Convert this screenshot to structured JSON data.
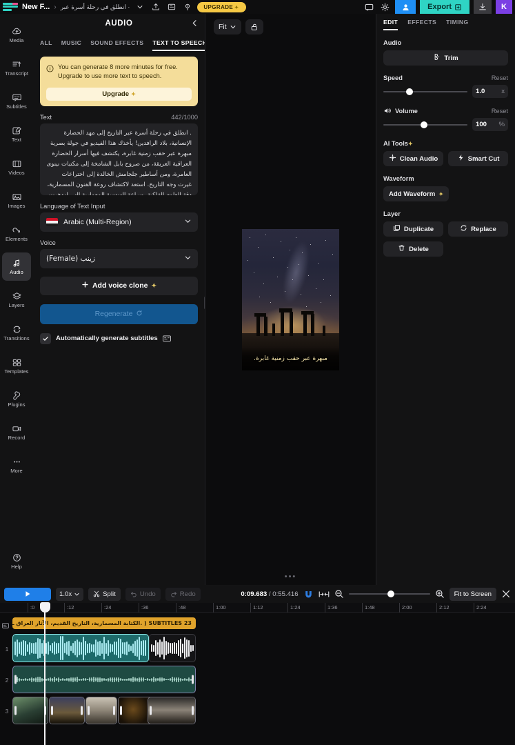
{
  "topbar": {
    "project_name": "New F...",
    "breadcrumb_separator": "›",
    "breadcrumb_arabic": "· انطلق في رحلة أسرة عبر",
    "upgrade_label": "UPGRADE",
    "sparkle": "✦",
    "export_label": "Export",
    "avatar_initial": "K",
    "icons": [
      "logo-icon",
      "chevron-down-icon",
      "upload-icon",
      "present-icon",
      "pin-icon",
      "comment-icon",
      "gear-icon",
      "invite-user-icon",
      "export-icon",
      "download-icon"
    ]
  },
  "rail": {
    "items": [
      {
        "label": "Media",
        "icon": "media-cloud-icon",
        "active": false
      },
      {
        "label": "Transcript",
        "icon": "transcript-icon",
        "active": false
      },
      {
        "label": "Subtitles",
        "icon": "subtitles-icon",
        "active": false
      },
      {
        "label": "Text",
        "icon": "text-edit-icon",
        "active": false
      },
      {
        "label": "Videos",
        "icon": "video-icon",
        "active": false
      },
      {
        "label": "Images",
        "icon": "image-icon",
        "active": false
      },
      {
        "label": "Elements",
        "icon": "elements-icon",
        "active": false
      },
      {
        "label": "Audio",
        "icon": "audio-note-icon",
        "active": true
      },
      {
        "label": "Layers",
        "icon": "layers-icon",
        "active": false
      },
      {
        "label": "Transitions",
        "icon": "transitions-icon",
        "active": false
      },
      {
        "label": "Templates",
        "icon": "templates-grid-icon",
        "active": false
      },
      {
        "label": "Plugins",
        "icon": "plugins-icon",
        "active": false
      },
      {
        "label": "Record",
        "icon": "record-camera-icon",
        "active": false
      },
      {
        "label": "More",
        "icon": "more-dots-icon",
        "active": false
      }
    ],
    "help_label": "Help"
  },
  "panel": {
    "title": "AUDIO",
    "tabs": [
      {
        "label": "ALL",
        "active": false
      },
      {
        "label": "MUSIC",
        "active": false
      },
      {
        "label": "SOUND EFFECTS",
        "active": false
      },
      {
        "label": "TEXT TO SPEECH",
        "active": true
      }
    ],
    "notice": {
      "line1": "You can generate 8 more minutes for free.",
      "line2": "Upgrade to use more text to speech.",
      "button_label": "Upgrade",
      "sparkle": "✦"
    },
    "text_field": {
      "label": "Text",
      "counter": "442/1000",
      "value": ". انطلق في رحلة أسرة عبر التاريخ إلى مهد الحضارة الإنسانية، بلاد الرافدين! يأخذك هذا الفيديو في جولة بصرية مبهرة عبر حقب زمنية غابرة، يكتشف فيها أسرار الحضارة العراقية العريقة، من صروح بابل الشامخة إلى مكتبات نينوى العامرة، ومن أساطير جلجامش الخالدة إلى اختراعات غيرت وجه التاريخ. استعد لاكتشاف روعة الفنون المسمارية، دقة العلوم الفلكية، وبراعة الهندسة المعمارية التي ازدهرت في بلاد ما بين النهرين. لتشكل"
    },
    "language_field": {
      "label": "Language of Text Input",
      "value": "Arabic (Multi-Region)",
      "flag": "iraq-flag-icon"
    },
    "voice_field": {
      "label": "Voice",
      "value": "زينب (Female)"
    },
    "add_voice_clone_label": "Add voice clone",
    "regenerate_label": "Regenerate",
    "auto_subtitles_label": "Automatically generate subtitles",
    "auto_subtitles_checked": true
  },
  "stage": {
    "fit_label": "Fit",
    "lock_icon": "unlock-icon",
    "subtitle_text": "مبهرة عبر حقب زمنية غابرة.",
    "handle_dots": "•••"
  },
  "inspector": {
    "tabs": [
      {
        "label": "EDIT",
        "active": true
      },
      {
        "label": "EFFECTS",
        "active": false
      },
      {
        "label": "TIMING",
        "active": false
      }
    ],
    "audio_section": {
      "label": "Audio",
      "trim_label": "Trim"
    },
    "speed": {
      "label": "Speed",
      "reset_label": "Reset",
      "value": "1.0",
      "unit": "x",
      "percent": 27
    },
    "volume": {
      "label": "Volume",
      "reset_label": "Reset",
      "value": "100",
      "unit": "%",
      "percent": 44
    },
    "ai_tools": {
      "label": "AI Tools",
      "sparkle": "✦",
      "clean_audio_label": "Clean Audio",
      "smart_cut_label": "Smart Cut"
    },
    "waveform": {
      "label": "Waveform",
      "add_label": "Add Waveform",
      "sparkle": "✦"
    },
    "layer": {
      "label": "Layer",
      "duplicate_label": "Duplicate",
      "replace_label": "Replace",
      "delete_label": "Delete"
    }
  },
  "transport": {
    "play_icon": "play-icon",
    "speed_value": "1.0x",
    "split_label": "Split",
    "undo_label": "Undo",
    "redo_label": "Redo",
    "current_time": "0:09.683",
    "total_time": "0:55.416",
    "time_separator": " / ",
    "fit_to_screen_label": "Fit to Screen",
    "icons": [
      "magnet-icon",
      "fit-selection-icon",
      "zoom-out-icon",
      "zoom-in-icon",
      "close-icon"
    ],
    "zoom_percent": 48
  },
  "timeline": {
    "ruler_ticks": [
      ":0",
      ":12",
      ":24",
      ":36",
      ":48",
      "1:00",
      "1:12",
      "1:24",
      "1:36",
      "1:48",
      "2:00",
      "2:12",
      "2:24"
    ],
    "subtitle_clip": {
      "label": "23 SUBTITLES ( .الكتابة المسمارية، التاريخ القديم، الآثار العراق ـــ",
      "count": "23 SUBTITLES"
    },
    "tracks": [
      {
        "number": "1",
        "type": "audio"
      },
      {
        "number": "2",
        "type": "audio"
      },
      {
        "number": "3",
        "type": "video"
      }
    ],
    "playhead_time": "0:09.683"
  },
  "colors": {
    "accent_blue": "#1f7fe8",
    "accent_teal": "#2fd4c4",
    "upgrade_yellow": "#f5c844",
    "notice_bg": "#f4dd9a",
    "subtitle_clip": "#e0a32b",
    "panel_bg": "#131314",
    "app_bg": "#0c0c0d",
    "avatar_purple": "#7b3fe4"
  }
}
